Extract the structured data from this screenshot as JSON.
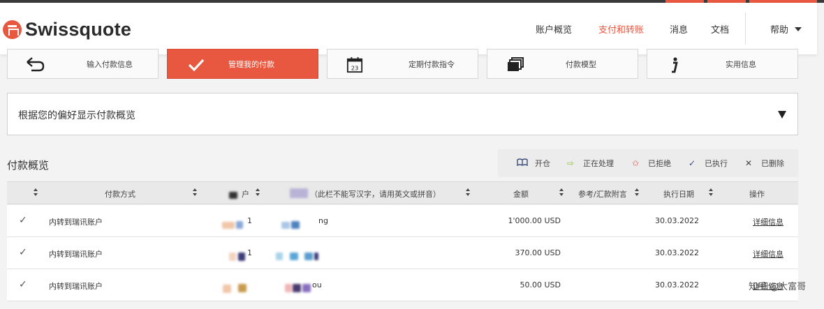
{
  "brand": {
    "name": "Swissquote",
    "accent": "#e8573f"
  },
  "nav": {
    "items": [
      "账户概览",
      "支付和转账",
      "消息",
      "文档"
    ],
    "active": "支付和转账",
    "help": "帮助"
  },
  "tabs": [
    {
      "label": "输入付款信息",
      "icon": "back-arrow-icon"
    },
    {
      "label": "管理我的付款",
      "icon": "checkmark-icon",
      "active": true
    },
    {
      "label": "定期付款指令",
      "icon": "calendar-icon",
      "icon_text": "23"
    },
    {
      "label": "付款模型",
      "icon": "stacked-cards-icon"
    },
    {
      "label": "实用信息",
      "icon": "info-icon"
    }
  ],
  "filter": {
    "label": "根据您的偏好显示付款概览"
  },
  "overview": {
    "title": "付款概览"
  },
  "legend": [
    {
      "icon": "book-icon",
      "label": "开仓"
    },
    {
      "icon": "arrow-right-icon",
      "label": "正在处理"
    },
    {
      "icon": "reject-star-icon",
      "label": "已拒绝"
    },
    {
      "icon": "checkmark-icon",
      "label": "已执行"
    },
    {
      "icon": "close-icon",
      "label": "已删除"
    }
  ],
  "table": {
    "headers": {
      "method": "付款方式",
      "account_suffix": "户",
      "beneficiary": "（此栏不能写汉字，请用英文或拼音）",
      "amount": "金额",
      "reference": "参考/汇款附言",
      "date": "执行日期",
      "action": "操作"
    },
    "rows": [
      {
        "method": "内转到瑞讯账户",
        "account": "1",
        "beneficiary": "ng",
        "amount": "1'000.00 USD",
        "date": "30.03.2022",
        "action": "详细信息"
      },
      {
        "method": "内转到瑞讯账户",
        "account": "1",
        "beneficiary": "",
        "amount": "370.00 USD",
        "date": "30.03.2022",
        "action": "详细信息"
      },
      {
        "method": "内转到瑞讯账户",
        "account": "",
        "beneficiary": "ou",
        "amount": "50.00 USD",
        "date": "30.03.2022",
        "action": "详细信息"
      }
    ]
  },
  "watermark": "知乎 @大富哥"
}
